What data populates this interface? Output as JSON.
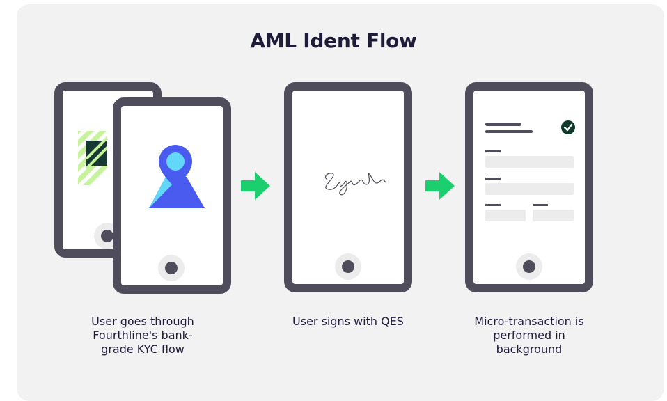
{
  "title": "AML Ident Flow",
  "steps": [
    {
      "caption_lines": [
        "User goes through",
        "Fourthline's bank-",
        "grade KYC flow"
      ],
      "icon": "user-location-icon"
    },
    {
      "caption_lines": [
        "User signs with QES"
      ],
      "icon": "signature-icon"
    },
    {
      "caption_lines": [
        "Micro-transaction is",
        "performed in",
        "background"
      ],
      "icon": "form-check-icon"
    }
  ],
  "colors": {
    "panel": "#f2f2f2",
    "phone_frame": "#4f4d5c",
    "arrow": "#1ccf6e",
    "pin": "#4a5cf0",
    "pin_inner": "#62d7f7",
    "check": "#0e3a2c",
    "stripe_lime": "#c6f39b",
    "title": "#1f1c3a"
  },
  "icons": [
    "arrow-right-icon",
    "check-icon",
    "striped-id-card-icon"
  ]
}
